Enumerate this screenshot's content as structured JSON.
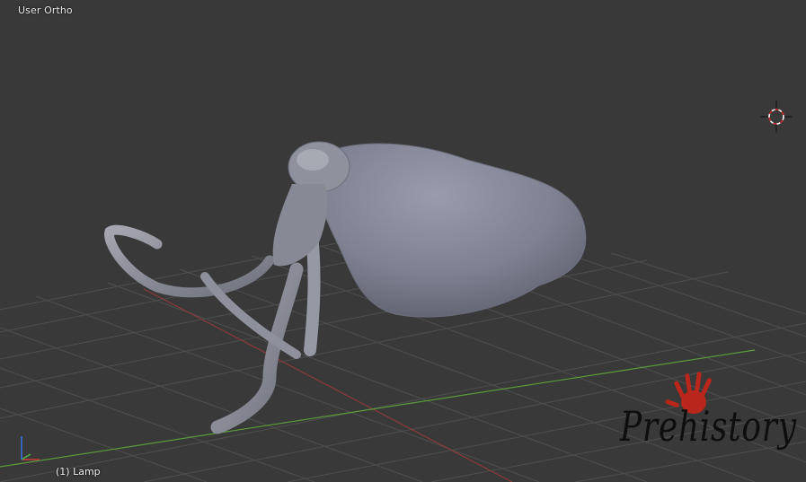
{
  "viewport": {
    "view_label": "User Ortho",
    "active_object_label": "(1) Lamp"
  },
  "watermark": {
    "text": "Prehistory",
    "hand_color": "#b8261c"
  },
  "colors": {
    "background": "#393939",
    "grid": "#4d4d4d",
    "x_axis": "#8a3b3b",
    "y_axis": "#5a9a3a",
    "mesh": "#8c8e9e"
  },
  "icons": {
    "cursor": "3d-cursor-icon",
    "gizmo": "axis-gizmo-icon"
  }
}
